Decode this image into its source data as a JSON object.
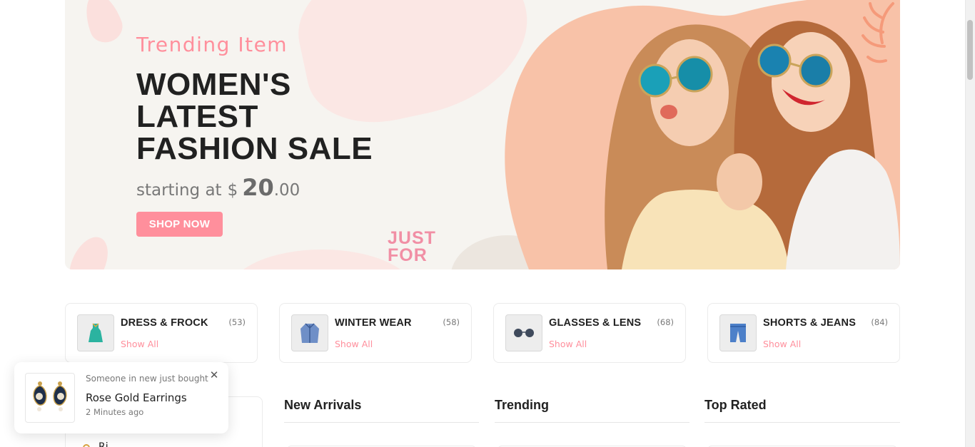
{
  "banner": {
    "subtitle": "Trending Item",
    "title": "WOMEN'S LATEST FASHION SALE",
    "price_prefix": "starting at",
    "currency": "$",
    "price_whole": "20",
    "price_cents": ".00",
    "cta_label": "SHOP NOW",
    "decor_text_line1": "JUST",
    "decor_text_line2": "FOR",
    "accent_color": "#ff8f9c"
  },
  "categories": [
    {
      "title": "DRESS & FROCK",
      "count": "(53)",
      "link": "Show All",
      "icon": "dress-icon"
    },
    {
      "title": "WINTER WEAR",
      "count": "(58)",
      "link": "Show All",
      "icon": "jacket-icon"
    },
    {
      "title": "GLASSES & LENS",
      "count": "(68)",
      "link": "Show All",
      "icon": "sunglasses-icon"
    },
    {
      "title": "SHORTS & JEANS",
      "count": "(84)",
      "link": "Show All",
      "icon": "jeans-icon"
    }
  ],
  "sections": {
    "new_arrivals": "New Arrivals",
    "trending": "Trending",
    "top_rated": "Top Rated"
  },
  "sidebar": {
    "partial_item": "Ri..."
  },
  "toast": {
    "message": "Someone in new just bought",
    "product": "Rose Gold Earrings",
    "time": "2 Minutes ago",
    "close_icon": "close-icon",
    "image_icon": "earrings-icon"
  }
}
